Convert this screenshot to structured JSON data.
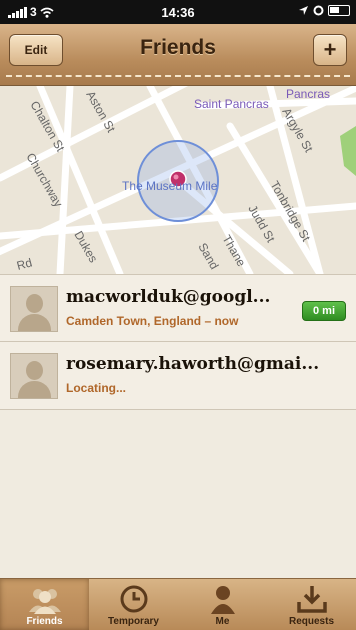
{
  "status_bar": {
    "carrier": "3",
    "time": "14:36"
  },
  "nav": {
    "title": "Friends",
    "edit_label": "Edit",
    "add_label": "+"
  },
  "map": {
    "street_labels": [
      "Chalton St",
      "Churchway",
      "Dukes",
      "Rd",
      "Aston St",
      "Saint Pancras",
      "Pancras",
      "Argyle St",
      "The Museum Mile",
      "Tonbridge St",
      "Judd St",
      "Thane",
      "Sand"
    ]
  },
  "friends": [
    {
      "name": "macworlduk@googl...",
      "status": "Camden Town, England – now",
      "distance": "0 mi"
    },
    {
      "name": "rosemary.haworth@gmai...",
      "status": "Locating..."
    }
  ],
  "tabs": [
    {
      "label": "Friends",
      "icon": "friends-icon",
      "active": true
    },
    {
      "label": "Temporary",
      "icon": "clock-icon",
      "active": false
    },
    {
      "label": "Me",
      "icon": "person-icon",
      "active": false
    },
    {
      "label": "Requests",
      "icon": "inbox-download-icon",
      "active": false
    }
  ]
}
